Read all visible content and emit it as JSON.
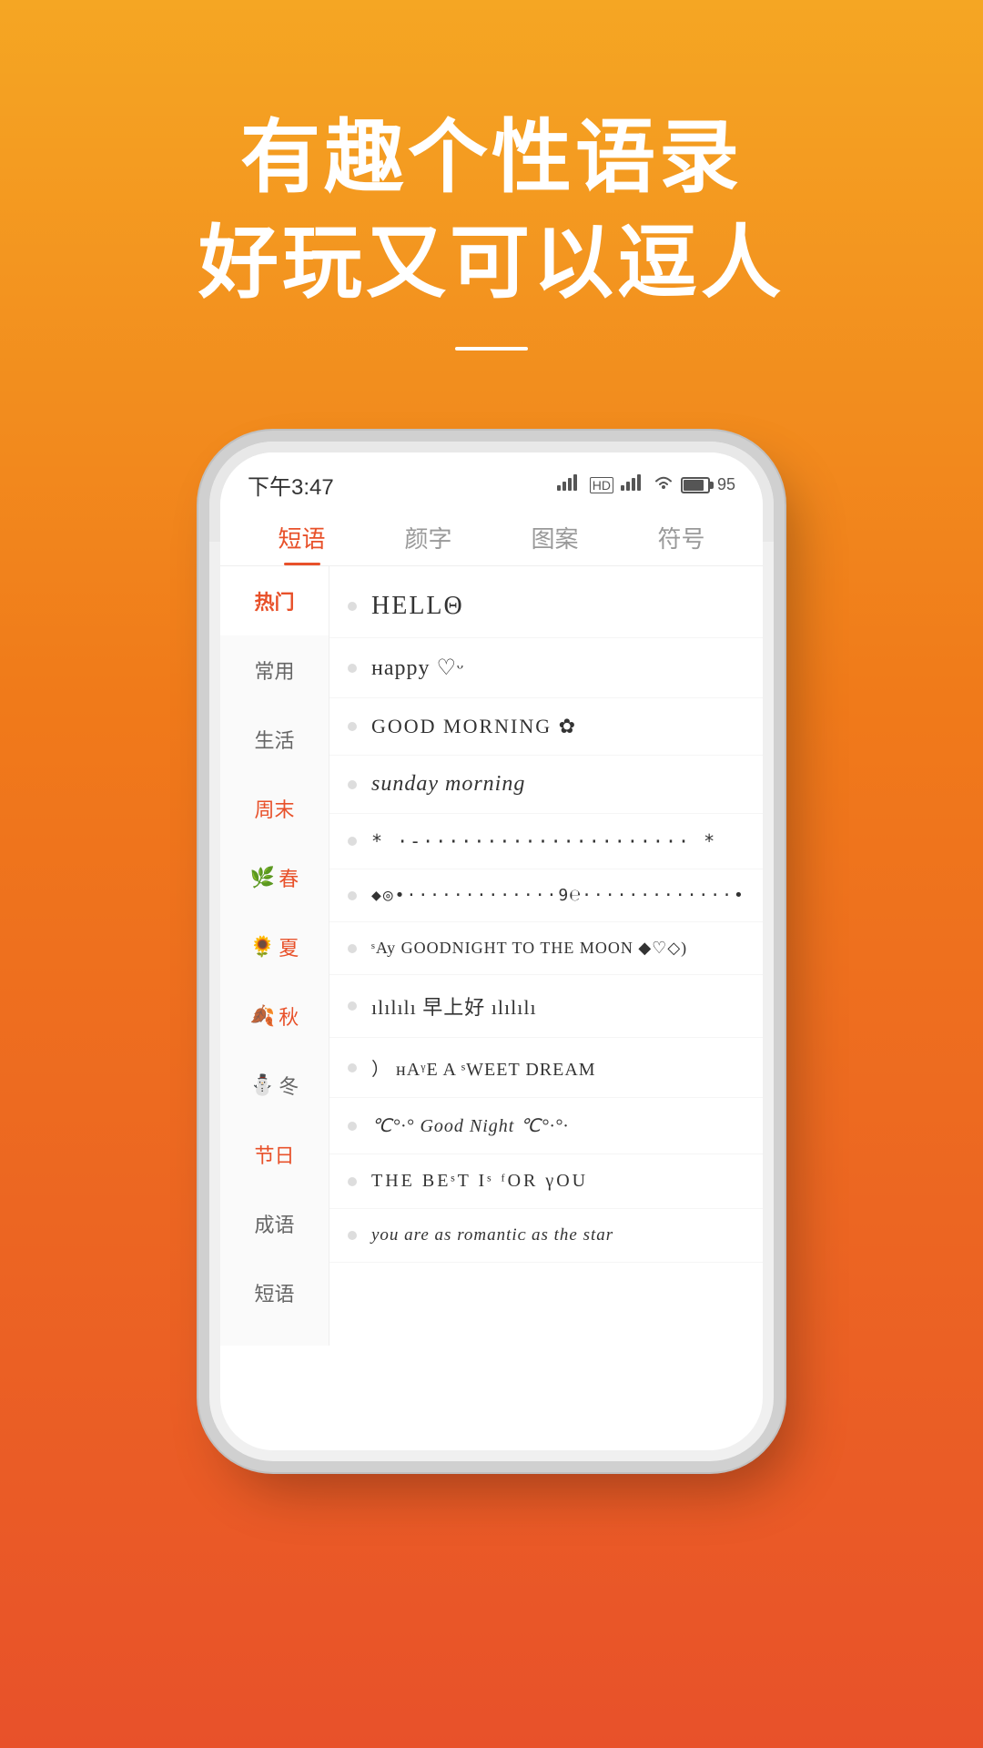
{
  "hero": {
    "title1": "有趣个性语录",
    "title2": "好玩又可以逗人"
  },
  "status_bar": {
    "time": "下午3:47",
    "battery": "95"
  },
  "tabs": [
    {
      "label": "短语",
      "active": true
    },
    {
      "label": "颜字",
      "active": false
    },
    {
      "label": "图案",
      "active": false
    },
    {
      "label": "符号",
      "active": false
    }
  ],
  "categories": [
    {
      "label": "热门",
      "active": true,
      "emoji": ""
    },
    {
      "label": "常用",
      "active": false,
      "emoji": ""
    },
    {
      "label": "生活",
      "active": false,
      "emoji": ""
    },
    {
      "label": "周末",
      "active": false,
      "emoji": ""
    },
    {
      "label": "春",
      "active": false,
      "emoji": "🌿"
    },
    {
      "label": "夏",
      "active": false,
      "emoji": "🌻"
    },
    {
      "label": "秋",
      "active": false,
      "emoji": "🍂"
    },
    {
      "label": "冬",
      "active": false,
      "emoji": "⛄"
    },
    {
      "label": "节日",
      "active": false,
      "emoji": ""
    },
    {
      "label": "成语",
      "active": false,
      "emoji": ""
    },
    {
      "label": "短语",
      "active": false,
      "emoji": ""
    }
  ],
  "phrases": [
    {
      "text": "HELLΘ"
    },
    {
      "text": "ʜappy ♡ᵕ"
    },
    {
      "text": "GOOD MORNING ✿"
    },
    {
      "text": "sunday morning",
      "italic": true
    },
    {
      "text": "* ·····················-··-·· *"
    },
    {
      "text": "◆◎•·····················9℮·····················•"
    },
    {
      "text": "ˢAy GOODNIGHT TO THE MOON ◆♡◇)"
    },
    {
      "text": "ılılılı 早上好 ılılılı"
    },
    {
      "text": "） ʜAᵞE A ˢWEET DREAM"
    },
    {
      "text": "℃°·° Good Night ℃°·°·"
    },
    {
      "text": "THE BEˢT Iˢ ᶠOR γOU"
    },
    {
      "text": "you are as romantiᴄ as the star"
    }
  ]
}
